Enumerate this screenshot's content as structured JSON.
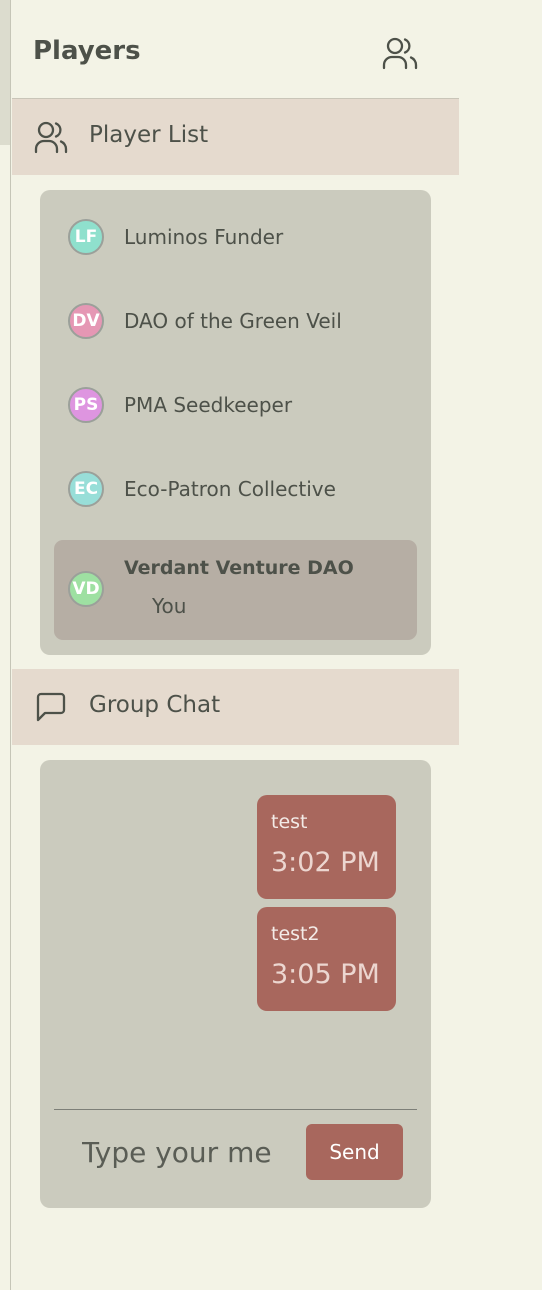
{
  "panel": {
    "title": "Players"
  },
  "player_list": {
    "label": "Player List",
    "players": [
      {
        "initials": "LF",
        "name": "Luminos Funder",
        "color": "#8fe0cd"
      },
      {
        "initials": "DV",
        "name": "DAO of the Green Veil",
        "color": "#e597b4"
      },
      {
        "initials": "PS",
        "name": "PMA Seedkeeper",
        "color": "#de95e0"
      },
      {
        "initials": "EC",
        "name": "Eco-Patron Collective",
        "color": "#98ded8"
      },
      {
        "initials": "VD",
        "name": "Verdant Venture DAO",
        "sub": "You",
        "color": "#9ee0a2",
        "current": true
      }
    ]
  },
  "group_chat": {
    "label": "Group Chat",
    "messages": [
      {
        "text": "test",
        "time": "3:02 PM"
      },
      {
        "text": "test2",
        "time": "3:05 PM"
      }
    ],
    "input_placeholder": "Type your me",
    "send_label": "Send"
  },
  "colors": {
    "accent": "#a8675d",
    "section_bar": "#e5dace",
    "card": "#cbcbbe",
    "background": "#f3f3e6"
  }
}
